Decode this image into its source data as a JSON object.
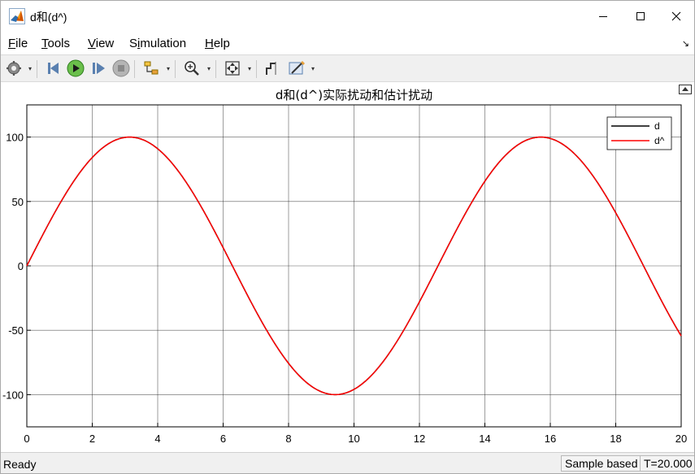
{
  "window": {
    "title": "d和(d^)",
    "app_icon": "matlab-icon"
  },
  "menu": {
    "items": [
      {
        "label": "File",
        "mnemonic": "F"
      },
      {
        "label": "Tools",
        "mnemonic": "T"
      },
      {
        "label": "View",
        "mnemonic": "V"
      },
      {
        "label": "Simulation",
        "mnemonic": "i"
      },
      {
        "label": "Help",
        "mnemonic": "H"
      }
    ],
    "collapse_glyph": "↘"
  },
  "toolbar": {
    "buttons": [
      {
        "name": "settings-icon"
      },
      {
        "name": "step-back-icon"
      },
      {
        "name": "run-icon"
      },
      {
        "name": "step-forward-icon"
      },
      {
        "name": "stop-icon"
      },
      {
        "name": "highlight-signal-icon"
      },
      {
        "name": "zoom-icon"
      },
      {
        "name": "fit-to-view-icon"
      },
      {
        "name": "cursor-measure-icon"
      },
      {
        "name": "style-icon"
      }
    ]
  },
  "chart_data": {
    "type": "line",
    "title": "d和(d^)实际扰动和估计扰动",
    "xlabel": "",
    "ylabel": "",
    "xlim": [
      0,
      20
    ],
    "ylim": [
      -125,
      125
    ],
    "xticks": [
      0,
      2,
      4,
      6,
      8,
      10,
      12,
      14,
      16,
      18,
      20
    ],
    "yticks": [
      -100,
      -50,
      0,
      50,
      100
    ],
    "grid": true,
    "legend_position": "top-right",
    "series": [
      {
        "name": "d",
        "color": "#000000",
        "function": "100*sin(0.5*t)",
        "x_start": 0,
        "x_end": 20
      },
      {
        "name": "d^",
        "color": "#ff0000",
        "function": "100*sin(0.5*t)",
        "x_start": 0,
        "x_end": 20
      }
    ],
    "sample_points": [
      {
        "x": 0,
        "y": 0
      },
      {
        "x": 3.14,
        "y": 100
      },
      {
        "x": 6.28,
        "y": 0
      },
      {
        "x": 9.42,
        "y": -100
      },
      {
        "x": 12.57,
        "y": 0
      },
      {
        "x": 15.71,
        "y": 100
      },
      {
        "x": 20,
        "y": -54.4
      }
    ]
  },
  "status": {
    "ready": "Ready",
    "sample_based": "Sample based",
    "time": "T=20.000"
  }
}
